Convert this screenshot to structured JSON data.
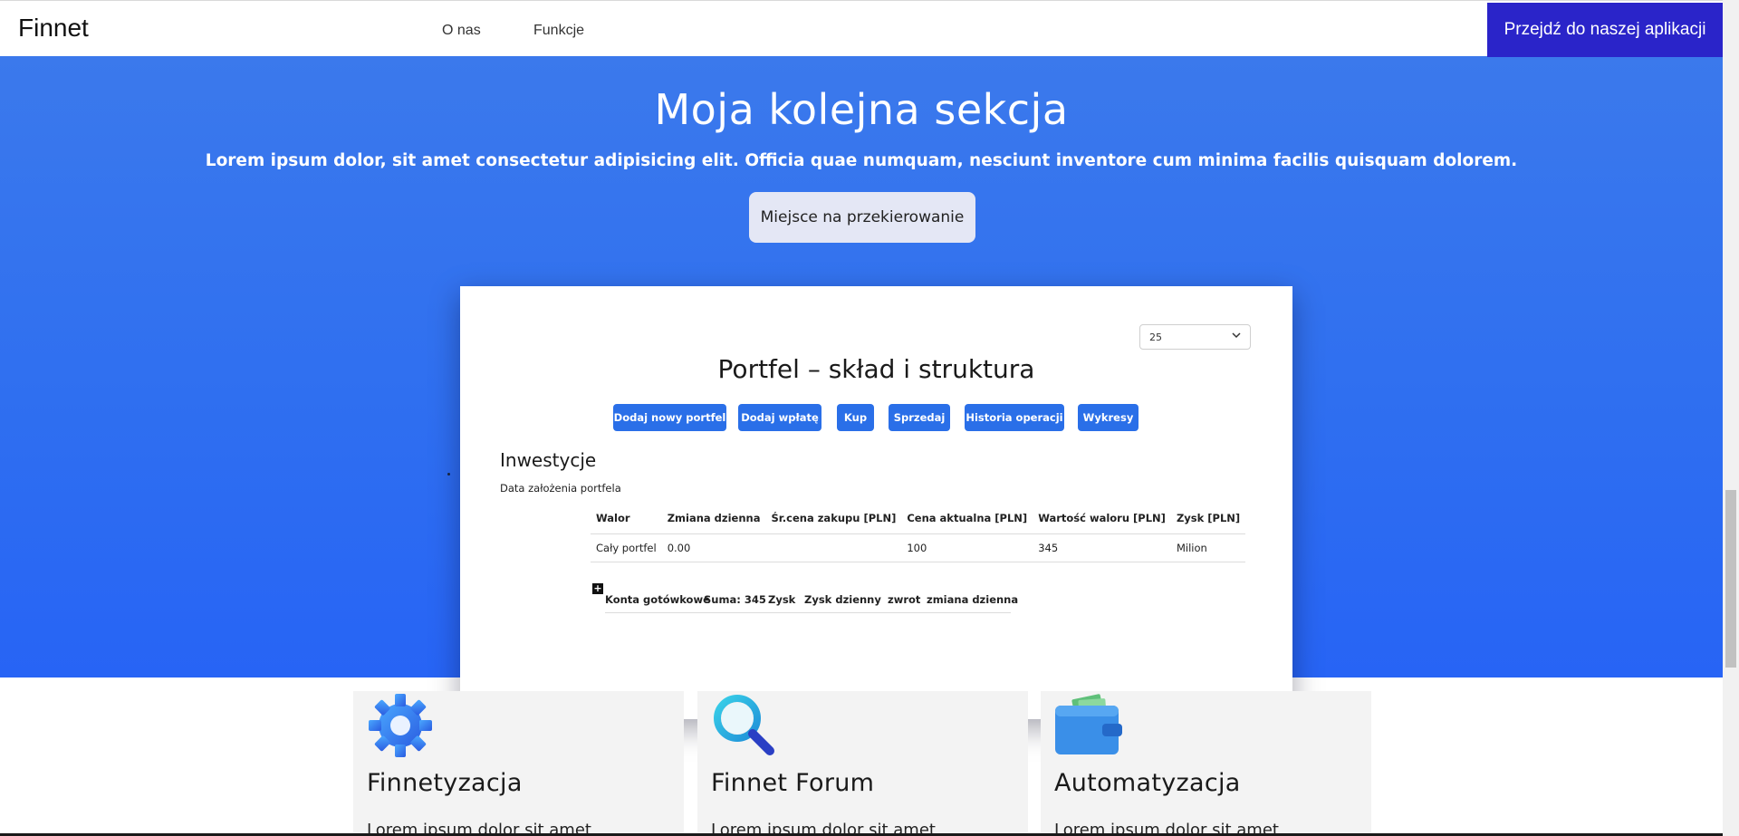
{
  "navbar": {
    "brand": "Finnet",
    "links": [
      "O nas",
      "Funkcje"
    ],
    "cta_label": "Przejdź do naszej aplikacji"
  },
  "hero": {
    "title": "Moja kolejna sekcja",
    "subtitle": "Lorem ipsum dolor, sit amet consectetur adipisicing elit. Officia quae numquam, nesciunt inventore cum minima facilis quisquam dolorem.",
    "button_label": "Miejsce na przekierowanie"
  },
  "preview": {
    "select_value": "25",
    "title": "Portfel – skład i struktura",
    "buttons": [
      "Dodaj nowy portfel",
      "Dodaj wpłatę",
      "Kup",
      "Sprzedaj",
      "Historia operacji",
      "Wykresy"
    ],
    "section_title": "Inwestycje",
    "date_label": "Data założenia portfela",
    "table": {
      "headers": [
        "Walor",
        "Zmiana dzienna",
        "Śr.cena zakupu [PLN]",
        "Cena aktualna [PLN]",
        "Wartość waloru [PLN]",
        "Zysk [PLN]"
      ],
      "rows": [
        [
          "Cały portfel",
          "0.00",
          "",
          "100",
          "345",
          "Milion"
        ]
      ]
    },
    "cash": {
      "expand_symbol": "+",
      "labels": [
        "Konta gotówkowe",
        "Suma: 345",
        "Zysk",
        "Zysk dzienny",
        "zwrot",
        "zmiana dzienna"
      ]
    }
  },
  "features": [
    {
      "title": "Finnetyzacja",
      "text": "Lorem ipsum dolor sit amet",
      "icon": "gear-icon"
    },
    {
      "title": "Finnet Forum",
      "text": "Lorem ipsum dolor sit amet",
      "icon": "search-icon"
    },
    {
      "title": "Automatyzacja",
      "text": "Lorem ipsum dolor sit amet",
      "icon": "wallet-icon"
    }
  ],
  "colors": {
    "accent": "#2a24c9",
    "hero_blue": "#2f6ff0",
    "button_blue": "#2a6fe8"
  }
}
